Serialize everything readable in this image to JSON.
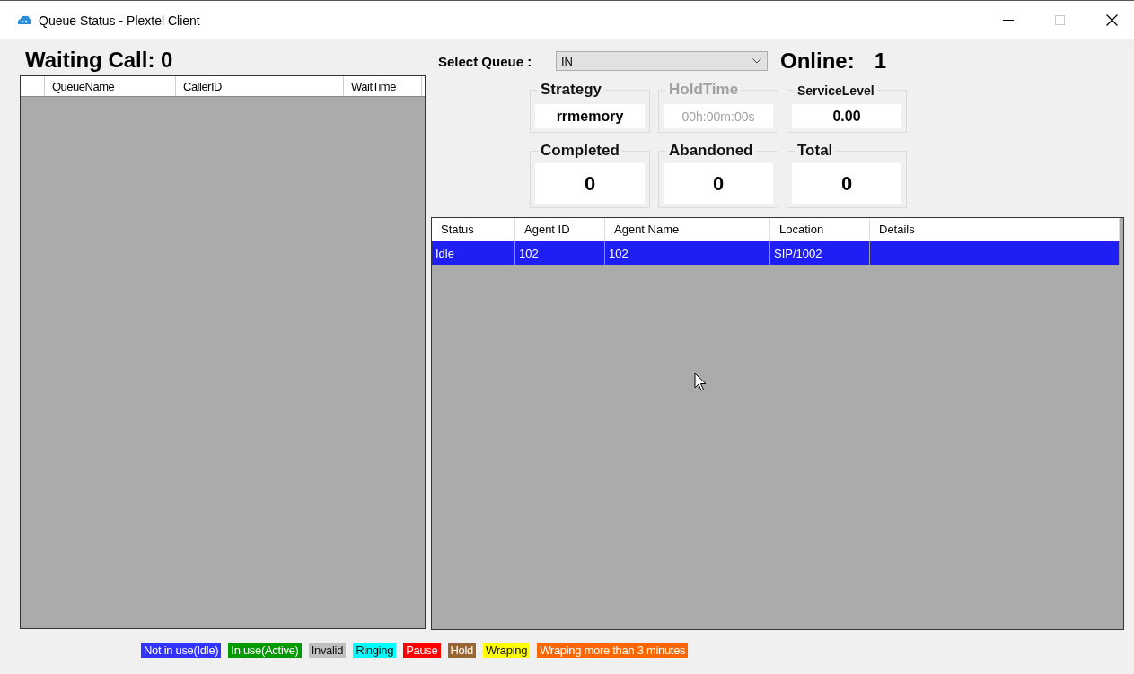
{
  "window": {
    "title": "Queue Status - Plextel Client"
  },
  "waiting": {
    "label": "Waiting Call: 0"
  },
  "calls_table": {
    "columns": [
      "QueueName",
      "CallerID",
      "WaitTime"
    ]
  },
  "select_queue": {
    "label": "Select Queue :",
    "value": "IN"
  },
  "online": {
    "label": "Online:",
    "value": "1"
  },
  "stats": [
    {
      "label": "Strategy",
      "value": "rrmemory",
      "disabled": false,
      "kind": "field"
    },
    {
      "label": "HoldTime",
      "value": "00h:00m:00s",
      "disabled": true,
      "kind": "field"
    },
    {
      "label": "ServiceLevel",
      "value": "0.00",
      "disabled": false,
      "kind": "field"
    },
    {
      "label": "Completed",
      "value": "0",
      "disabled": false,
      "kind": "counter"
    },
    {
      "label": "Abandoned",
      "value": "0",
      "disabled": false,
      "kind": "counter"
    },
    {
      "label": "Total",
      "value": "0",
      "disabled": false,
      "kind": "counter"
    }
  ],
  "agents_table": {
    "columns": [
      "Status",
      "Agent ID",
      "Agent Name",
      "Location",
      "Details"
    ],
    "rows": [
      {
        "cells": [
          "Idle",
          "102",
          "102",
          "SIP/1002",
          ""
        ],
        "selected": true
      }
    ]
  },
  "legend": [
    {
      "label": "Not in use(Idle)",
      "color": "#3333ff"
    },
    {
      "label": "In use(Active)",
      "color": "#009900"
    },
    {
      "label": "Invalid",
      "color": "#c0c0c0"
    },
    {
      "label": "Ringing",
      "color": "#00ffff"
    },
    {
      "label": "Pause",
      "color": "#ff0000"
    },
    {
      "label": "Hold",
      "color": "#996633"
    },
    {
      "label": "Wraping",
      "color": "#ffff00"
    },
    {
      "label": "Wraping more than 3 minutes",
      "color": "#ff6600"
    }
  ]
}
